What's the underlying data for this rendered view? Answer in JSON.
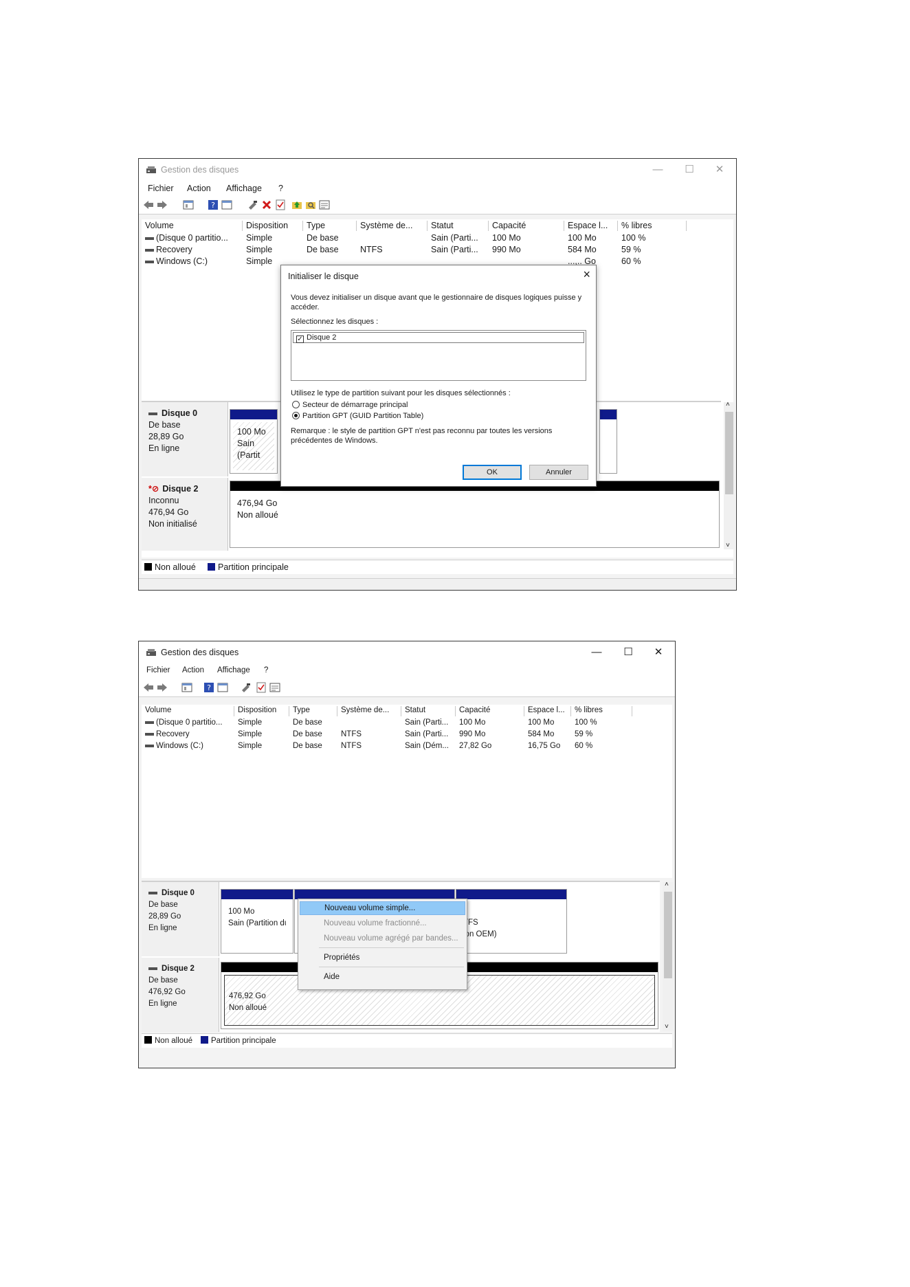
{
  "window1": {
    "title": "Gestion des disques",
    "menu": [
      "Fichier",
      "Action",
      "Affichage",
      "?"
    ],
    "columns": [
      "Volume",
      "Disposition",
      "Type",
      "Système de...",
      "Statut",
      "Capacité",
      "Espace l...",
      "% libres"
    ],
    "rows": [
      [
        "(Disque 0 partitio...",
        "Simple",
        "De base",
        "",
        "Sain (Parti...",
        "100 Mo",
        "100 Mo",
        "100 %"
      ],
      [
        "Recovery",
        "Simple",
        "De base",
        "NTFS",
        "Sain (Parti...",
        "990 Mo",
        "584 Mo",
        "59 %"
      ],
      [
        "Windows (C:)",
        "Simple",
        "",
        "",
        "",
        "",
        "...,.. Go",
        "60 %"
      ]
    ],
    "disks": [
      {
        "name": "Disque 0",
        "type": "De base",
        "size": "28,89 Go",
        "state": "En ligne",
        "vol_size": "100 Mo",
        "vol_status": "Sain (Partit"
      },
      {
        "name": "Disque 2",
        "type": "Inconnu",
        "size": "476,94 Go",
        "state": "Non initialisé",
        "vol_size": "476,94 Go",
        "vol_status": "Non alloué"
      }
    ],
    "legend": [
      "Non alloué",
      "Partition principale"
    ],
    "dialog": {
      "title": "Initialiser le disque",
      "intro": "Vous devez initialiser un disque avant que le gestionnaire de disques logiques puisse y accéder.",
      "select_label": "Sélectionnez les disques :",
      "disk_item": "Disque 2",
      "partition_label": "Utilisez le type de partition suivant pour les disques sélectionnés :",
      "option_mbr": "Secteur de démarrage principal",
      "option_gpt": "Partition GPT (GUID Partition Table)",
      "note": "Remarque : le style de partition GPT n'est pas reconnu par toutes les versions précédentes de Windows.",
      "ok": "OK",
      "cancel": "Annuler",
      "close": "×"
    }
  },
  "window2": {
    "title": "Gestion des disques",
    "menu": [
      "Fichier",
      "Action",
      "Affichage",
      "?"
    ],
    "columns": [
      "Volume",
      "Disposition",
      "Type",
      "Système de...",
      "Statut",
      "Capacité",
      "Espace l...",
      "% libres"
    ],
    "rows": [
      [
        "(Disque 0 partitio...",
        "Simple",
        "De base",
        "",
        "Sain (Parti...",
        "100 Mo",
        "100 Mo",
        "100 %"
      ],
      [
        "Recovery",
        "Simple",
        "De base",
        "NTFS",
        "Sain (Parti...",
        "990 Mo",
        "584 Mo",
        "59 %"
      ],
      [
        "Windows (C:)",
        "Simple",
        "De base",
        "NTFS",
        "Sain (Dém...",
        "27,82 Go",
        "16,75 Go",
        "60 %"
      ]
    ],
    "disks": [
      {
        "name": "Disque 0",
        "type": "De base",
        "size": "28,89 Go",
        "state": "En ligne",
        "vol_size": "100 Mo",
        "vol_status": "Sain (Partition du",
        "vol3_fs": "TFS",
        "vol3_status": "ion OEM)"
      },
      {
        "name": "Disque 2",
        "type": "De base",
        "size": "476,92 Go",
        "state": "En ligne",
        "vol_size": "476,92 Go",
        "vol_status": "Non alloué"
      }
    ],
    "legend": [
      "Non alloué",
      "Partition principale"
    ],
    "context_menu": [
      "Nouveau volume simple...",
      "Nouveau volume fractionné...",
      "Nouveau volume agrégé par bandes...",
      "Propriétés",
      "Aide"
    ]
  },
  "colors": {
    "primary_partition": "#101a8a",
    "unallocated": "#000000",
    "highlight": "#91c9f7",
    "accent": "#0078d7",
    "delete_icon": "#d11a1a"
  }
}
